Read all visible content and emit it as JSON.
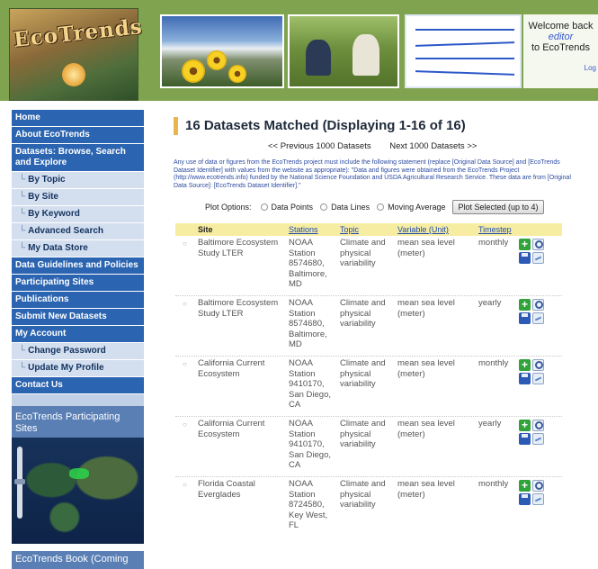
{
  "header": {
    "logo_text": "EcoTrends",
    "welcome_line1": "Welcome back",
    "welcome_user": "editor",
    "welcome_line2": "to EcoTrends",
    "logout": "Log"
  },
  "sidebar": {
    "items": [
      {
        "label": "Home",
        "type": "main"
      },
      {
        "label": "About EcoTrends",
        "type": "main"
      },
      {
        "label": "Datasets: Browse, Search and Explore",
        "type": "main"
      },
      {
        "label": "By Topic",
        "type": "sub"
      },
      {
        "label": "By Site",
        "type": "sub"
      },
      {
        "label": "By Keyword",
        "type": "sub"
      },
      {
        "label": "Advanced Search",
        "type": "sub"
      },
      {
        "label": "My Data Store",
        "type": "sub"
      },
      {
        "label": "Data Guidelines and Policies",
        "type": "main"
      },
      {
        "label": "Participating Sites",
        "type": "main"
      },
      {
        "label": "Publications",
        "type": "main"
      },
      {
        "label": "Submit New Datasets",
        "type": "main"
      },
      {
        "label": "My Account",
        "type": "main"
      },
      {
        "label": "Change Password",
        "type": "sub"
      },
      {
        "label": "Update My Profile",
        "type": "sub"
      },
      {
        "label": "Contact Us",
        "type": "main"
      }
    ],
    "participating_title": "EcoTrends Participating Sites",
    "book_title": "EcoTrends Book (Coming"
  },
  "main": {
    "title": "16 Datasets Matched (Displaying 1-16 of 16)",
    "prev": "<< Previous 1000 Datasets",
    "next": "Next 1000 Datasets >>",
    "notice": "Any use of data or figures from the EcoTrends project must include the following statement (replace [Original Data Source] and [EcoTrends Dataset Identifier] with values from the website as appropriate): \"Data and figures were obtained from the EcoTrends Project (http://www.ecotrends.info) funded by the National Science Foundation and USDA Agricultural Research Service. These data are from [Original Data Source]: [EcoTrends Dataset Identifier].\"",
    "plot_options": {
      "label": "Plot Options:",
      "points": "Data Points",
      "lines": "Data Lines",
      "average": "Moving Average",
      "button": "Plot Selected (up to 4)"
    }
  },
  "table": {
    "columns": {
      "site": "Site",
      "stations": "Stations",
      "topic": "Topic",
      "variable": "Variable (Unit)",
      "timestep": "Timestep"
    },
    "rows": [
      {
        "site": "Baltimore Ecosystem Study LTER",
        "station": "NOAA Station 8574680, Baltimore, MD",
        "topic": "Climate and physical variability",
        "variable": "mean sea level (meter)",
        "timestep": "monthly"
      },
      {
        "site": "Baltimore Ecosystem Study LTER",
        "station": "NOAA Station 8574680, Baltimore, MD",
        "topic": "Climate and physical variability",
        "variable": "mean sea level (meter)",
        "timestep": "yearly"
      },
      {
        "site": "California Current Ecosystem",
        "station": "NOAA Station 9410170, San Diego, CA",
        "topic": "Climate and physical variability",
        "variable": "mean sea level (meter)",
        "timestep": "monthly"
      },
      {
        "site": "California Current Ecosystem",
        "station": "NOAA Station 9410170, San Diego, CA",
        "topic": "Climate and physical variability",
        "variable": "mean sea level (meter)",
        "timestep": "yearly"
      },
      {
        "site": "Florida Coastal Everglades",
        "station": "NOAA Station 8724580, Key West, FL",
        "topic": "Climate and physical variability",
        "variable": "mean sea level (meter)",
        "timestep": "monthly"
      }
    ]
  }
}
